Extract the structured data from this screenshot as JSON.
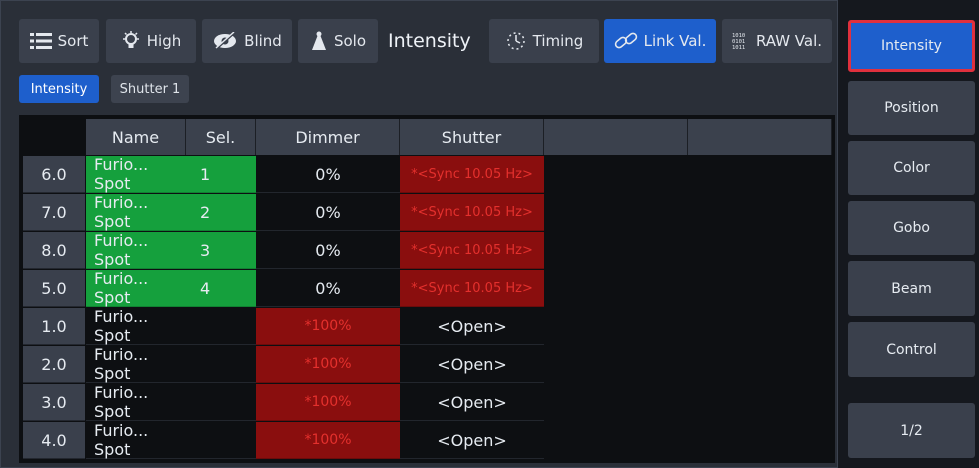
{
  "toolbar": {
    "sort_label": "Sort",
    "high_label": "High",
    "blind_label": "Blind",
    "solo_label": "Solo",
    "title": "Intensity",
    "timing_label": "Timing",
    "link_label": "Link Val.",
    "raw_label": "RAW Val."
  },
  "tabs": [
    "Intensity",
    "Shutter 1"
  ],
  "table": {
    "headers": [
      "Name",
      "Sel.",
      "Dimmer",
      "Shutter"
    ],
    "rows": [
      {
        "id": "6.0",
        "name": "Furio... Spot",
        "sel": "1",
        "dimmer": "0%",
        "shutter": "*<Sync 10.05 Hz>"
      },
      {
        "id": "7.0",
        "name": "Furio... Spot",
        "sel": "2",
        "dimmer": "0%",
        "shutter": "*<Sync 10.05 Hz>"
      },
      {
        "id": "8.0",
        "name": "Furio... Spot",
        "sel": "3",
        "dimmer": "0%",
        "shutter": "*<Sync 10.05 Hz>"
      },
      {
        "id": "5.0",
        "name": "Furio... Spot",
        "sel": "4",
        "dimmer": "0%",
        "shutter": "*<Sync 10.05 Hz>"
      },
      {
        "id": "1.0",
        "name": "Furio... Spot",
        "sel": "",
        "dimmer": "*100%",
        "shutter": "<Open>"
      },
      {
        "id": "2.0",
        "name": "Furio... Spot",
        "sel": "",
        "dimmer": "*100%",
        "shutter": "<Open>"
      },
      {
        "id": "3.0",
        "name": "Furio... Spot",
        "sel": "",
        "dimmer": "*100%",
        "shutter": "<Open>"
      },
      {
        "id": "4.0",
        "name": "Furio... Spot",
        "sel": "",
        "dimmer": "*100%",
        "shutter": "<Open>"
      }
    ]
  },
  "feature_buttons": [
    "Intensity",
    "Position",
    "Color",
    "Gobo",
    "Beam",
    "Control",
    "1/2"
  ],
  "colors": {
    "accent_blue": "#1e5fcc",
    "selected_green": "#15a03d",
    "programmer_red": "#8a0e0e",
    "active_outline": "#e0303d"
  }
}
